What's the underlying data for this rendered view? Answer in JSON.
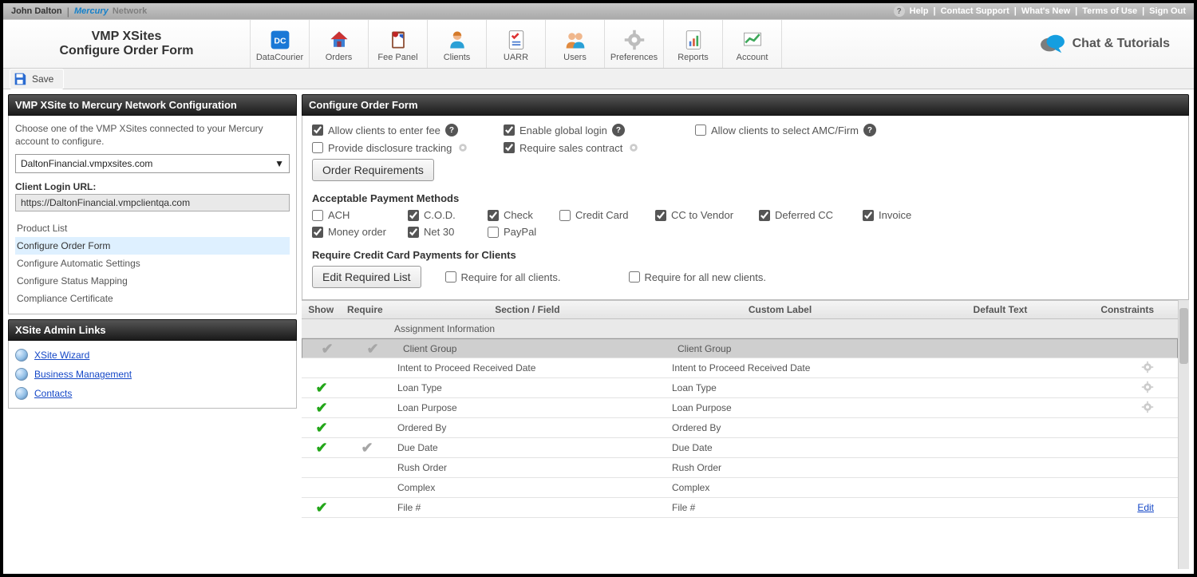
{
  "topbar": {
    "username": "John Dalton",
    "brand_left": "Mercury",
    "brand_right": "Network",
    "help": "Help",
    "contact": "Contact Support",
    "whatsnew": "What's New",
    "terms": "Terms of Use",
    "signout": "Sign Out"
  },
  "header": {
    "title1": "VMP XSites",
    "title2": "Configure Order Form",
    "chat": "Chat & Tutorials"
  },
  "nav": {
    "datacourier": "DataCourier",
    "orders": "Orders",
    "feepanel": "Fee Panel",
    "clients": "Clients",
    "uarr": "UARR",
    "users": "Users",
    "preferences": "Preferences",
    "reports": "Reports",
    "account": "Account"
  },
  "save_label": "Save",
  "left": {
    "panel1_title": "VMP XSite to Mercury Network Configuration",
    "intro": "Choose one of the VMP XSites connected to your Mercury account to configure.",
    "dropdown_value": "DaltonFinancial.vmpxsites.com",
    "client_login_label": "Client Login URL:",
    "client_login_value": "https://DaltonFinancial.vmpclientqa.com",
    "nav": {
      "product": "Product List",
      "configure": "Configure Order Form",
      "auto": "Configure Automatic Settings",
      "status": "Configure Status Mapping",
      "compliance": "Compliance Certificate"
    },
    "panel2_title": "XSite Admin Links",
    "links": {
      "wizard": "XSite Wizard",
      "business": "Business Management",
      "contacts": "Contacts"
    }
  },
  "main": {
    "title": "Configure Order Form",
    "opts": {
      "allow_fee": "Allow clients to enter fee",
      "global_login": "Enable global login",
      "select_amc": "Allow clients to select AMC/Firm",
      "disclosure": "Provide disclosure tracking",
      "sales_contract": "Require sales contract"
    },
    "order_req_btn": "Order Requirements",
    "pay_header": "Acceptable Payment Methods",
    "pay": {
      "ach": "ACH",
      "cod": "C.O.D.",
      "check": "Check",
      "credit": "Credit Card",
      "ccvendor": "CC to Vendor",
      "deferred": "Deferred CC",
      "invoice": "Invoice",
      "money": "Money order",
      "net30": "Net 30",
      "paypal": "PayPal"
    },
    "req_cc_header": "Require Credit Card Payments for Clients",
    "edit_required_btn": "Edit Required List",
    "req_all": "Require for all clients.",
    "req_new": "Require for all new clients.",
    "cols": {
      "show": "Show",
      "require": "Require",
      "section": "Section / Field",
      "custom": "Custom Label",
      "default": "Default Text",
      "constraints": "Constraints"
    },
    "section_assign": "Assignment Information",
    "rows": [
      {
        "field": "Client Group",
        "custom": "Client Group",
        "show": "grey",
        "require": "grey",
        "gear": false,
        "selected": true
      },
      {
        "field": "Intent to Proceed Received Date",
        "custom": "Intent to Proceed Received Date",
        "show": "",
        "require": "",
        "gear": true
      },
      {
        "field": "Loan Type",
        "custom": "Loan Type",
        "show": "green",
        "require": "",
        "gear": true
      },
      {
        "field": "Loan Purpose",
        "custom": "Loan Purpose",
        "show": "green",
        "require": "",
        "gear": true
      },
      {
        "field": "Ordered By",
        "custom": "Ordered By",
        "show": "green",
        "require": ""
      },
      {
        "field": "Due Date",
        "custom": "Due Date",
        "show": "green",
        "require": "grey"
      },
      {
        "field": "Rush Order",
        "custom": "Rush Order",
        "show": "",
        "require": ""
      },
      {
        "field": "Complex",
        "custom": "Complex",
        "show": "",
        "require": ""
      },
      {
        "field": "File #",
        "custom": "File #",
        "show": "green",
        "require": "",
        "edit": "Edit"
      }
    ]
  }
}
